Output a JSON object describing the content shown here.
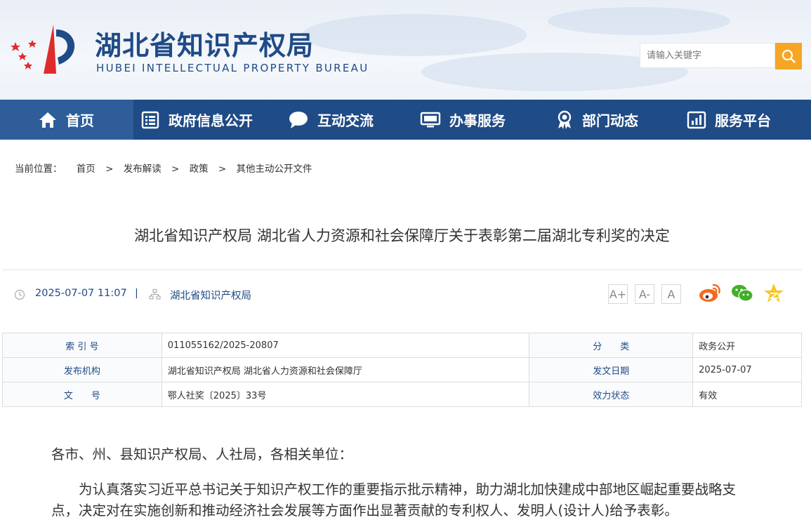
{
  "site": {
    "name_cn": "湖北省知识产权局",
    "name_en": "HUBEI INTELLECTUAL PROPERTY BUREAU",
    "search_placeholder": "请输入关键字"
  },
  "nav": [
    {
      "label": "首页",
      "icon": "home-icon"
    },
    {
      "label": "政府信息公开",
      "icon": "document-list-icon"
    },
    {
      "label": "互动交流",
      "icon": "chat-bubble-icon"
    },
    {
      "label": "办事服务",
      "icon": "monitor-icon"
    },
    {
      "label": "部门动态",
      "icon": "award-icon"
    },
    {
      "label": "服务平台",
      "icon": "bar-chart-icon"
    }
  ],
  "breadcrumb": {
    "prefix": "当前位置：",
    "items": [
      "首页",
      "发布解读",
      "政策",
      "其他主动公开文件"
    ],
    "separator": ">"
  },
  "article": {
    "title": "湖北省知识产权局 湖北省人力资源和社会保障厅关于表彰第二届湖北专利奖的决定",
    "datetime": "2025-07-07 11:07",
    "meta_separator": "|",
    "source": "湖北省知识产权局",
    "font_buttons": [
      "A+",
      "A-",
      "A"
    ]
  },
  "info_table": {
    "rows": [
      {
        "k1": "索 引 号",
        "v1": "011055162/2025-20807",
        "k2": "分　　类",
        "v2": "政务公开"
      },
      {
        "k1": "发布机构",
        "v1": "湖北省知识产权局 湖北省人力资源和社会保障厅",
        "k2": "发文日期",
        "v2": "2025-07-07"
      },
      {
        "k1": "文　　号",
        "v1": "鄂人社奖〔2025〕33号",
        "k2": "效力状态",
        "v2": "有效"
      }
    ]
  },
  "body": {
    "salutation": "各市、州、县知识产权局、人社局，各相关单位：",
    "p1_line1": "为认真落实习近平总书记关于知识产权工作的重要指示批示精神，助力湖北加快建成中部地区崛起重要战略支",
    "p1_line2": "点，决定对在实施创新和推动经济社会发展等方面作出显著贡献的专利权人、发明人(设计人)给予表彰。"
  },
  "colors": {
    "brand_blue": "#1f4b86",
    "nav_active": "#2e5d9a",
    "search_orange": "#f6a623",
    "logo_red": "#e02b2b"
  }
}
